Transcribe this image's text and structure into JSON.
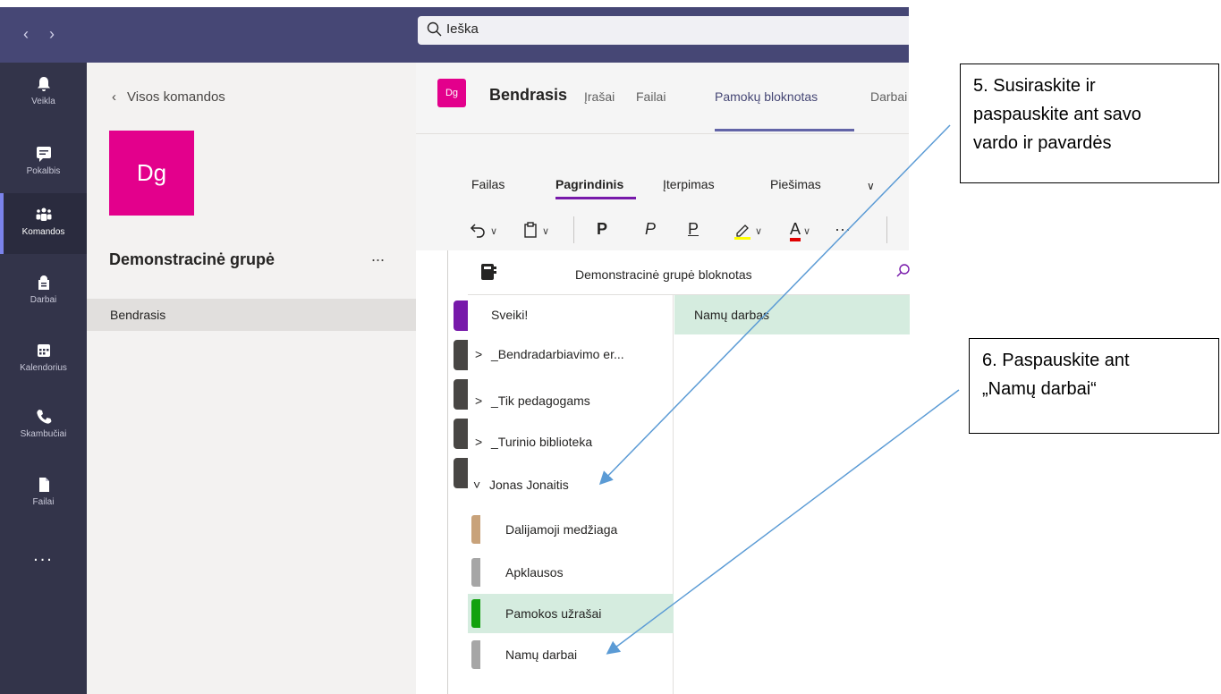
{
  "titlebar": {
    "search_placeholder": "Ieška"
  },
  "appbar": {
    "items": [
      {
        "label": "Veikla",
        "icon": "bell-icon"
      },
      {
        "label": "Pokalbis",
        "icon": "chat-icon"
      },
      {
        "label": "Komandos",
        "icon": "teams-icon"
      },
      {
        "label": "Darbai",
        "icon": "assignments-icon"
      },
      {
        "label": "Kalendorius",
        "icon": "calendar-icon"
      },
      {
        "label": "Skambučiai",
        "icon": "phone-icon"
      },
      {
        "label": "Failai",
        "icon": "file-icon"
      }
    ],
    "more": "..."
  },
  "teampanel": {
    "back_label": "Visos komandos",
    "logo_text": "Dg",
    "team_name": "Demonstracinė grupė",
    "more": "...",
    "channel": "Bendrasis"
  },
  "channel_header": {
    "logo_text": "Dg",
    "title": "Bendrasis",
    "tabs": [
      "Įrašai",
      "Failai",
      "Pamokų bloknotas",
      "Darbai"
    ]
  },
  "ribbon": {
    "tabs": [
      "Failas",
      "Pagrindinis",
      "Įterpimas",
      "Piešimas"
    ],
    "tools": {
      "bold": "P",
      "italic": "P",
      "underline": "P",
      "font_color": "A",
      "more": "···"
    }
  },
  "notebook": {
    "title": "Demonstracinė grupė bloknotas",
    "sections": [
      {
        "label": "Sveiki!",
        "prefix": ""
      },
      {
        "label": "_Bendradarbiavimo er...",
        "prefix": ">"
      },
      {
        "label": "_Tik pedagogams",
        "prefix": ">"
      },
      {
        "label": "_Turinio biblioteka",
        "prefix": ">"
      },
      {
        "label": "Jonas Jonaitis",
        "prefix": "˅"
      },
      {
        "label": "Dalijamoji medžiaga",
        "prefix": ""
      },
      {
        "label": "Apklausos",
        "prefix": ""
      },
      {
        "label": "Pamokos užrašai",
        "prefix": ""
      },
      {
        "label": "Namų darbai",
        "prefix": ""
      }
    ],
    "page_selected": "Namų darbas"
  },
  "callouts": {
    "step5": [
      "5. Susiraskite ir",
      "paspauskite ant savo",
      "vardo ir pavardės"
    ],
    "step6": [
      "6. Paspauskite ant",
      "„Namų darbai“"
    ]
  },
  "colors": {
    "titlebar": "#464775",
    "appbar": "#33344a",
    "team_accent": "#e3008c",
    "selection": "#d5ecdf",
    "arrow": "#5b9bd5"
  }
}
